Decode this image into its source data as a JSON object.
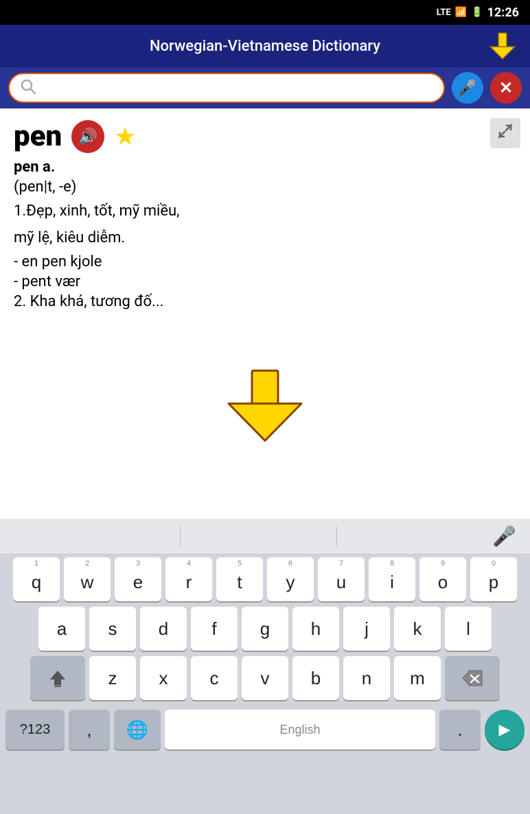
{
  "statusBar": {
    "time": "12:26",
    "lte": "LTE",
    "battery": "🔋",
    "signal": "📶"
  },
  "header": {
    "title": "Norwegian-Vietnamese Dictionary",
    "arrowLabel": "download-arrow"
  },
  "searchBar": {
    "placeholder": "",
    "micLabel": "microphone",
    "closeLabel": "clear"
  },
  "dictContent": {
    "word": "pen",
    "speakerLabel": "play-audio",
    "starLabel": "favorite",
    "expandLabel": "expand",
    "partOfSpeech": "pen a.",
    "phonetic": "(pen|t, -e)",
    "meaning1": "1.Đẹp, xinh, tốt, mỹ miều,",
    "meaning2": "mỹ lệ, kiêu diễm.",
    "example1": "- en pen kjole",
    "example2": "- pent vær",
    "example3": "2. Kha khá, tương đố..."
  },
  "keyboard": {
    "micLabel": "keyboard-microphone",
    "row1": [
      {
        "letter": "q",
        "number": "1"
      },
      {
        "letter": "w",
        "number": "2"
      },
      {
        "letter": "e",
        "number": "3"
      },
      {
        "letter": "r",
        "number": "4"
      },
      {
        "letter": "t",
        "number": "5"
      },
      {
        "letter": "y",
        "number": "6"
      },
      {
        "letter": "u",
        "number": "7"
      },
      {
        "letter": "i",
        "number": "8"
      },
      {
        "letter": "o",
        "number": "9"
      },
      {
        "letter": "p",
        "number": "0"
      }
    ],
    "row2": [
      {
        "letter": "a"
      },
      {
        "letter": "s"
      },
      {
        "letter": "d"
      },
      {
        "letter": "f"
      },
      {
        "letter": "g"
      },
      {
        "letter": "h"
      },
      {
        "letter": "j"
      },
      {
        "letter": "k"
      },
      {
        "letter": "l"
      }
    ],
    "row3": [
      {
        "letter": "z"
      },
      {
        "letter": "x"
      },
      {
        "letter": "c"
      },
      {
        "letter": "v"
      },
      {
        "letter": "b"
      },
      {
        "letter": "n"
      },
      {
        "letter": "m"
      }
    ],
    "bottomRow": {
      "sym": "?123",
      "comma": ",",
      "globe": "🌐",
      "space": "English",
      "period": ".",
      "enter": "▶"
    }
  },
  "colors": {
    "headerBg": "#1a237e",
    "searchBg": "#283593",
    "micBtn": "#1e88e5",
    "closeBtn": "#c62828",
    "speakerBtn": "#c62828",
    "arrowYellow": "#FFD600",
    "enterBtn": "#26a69a"
  }
}
